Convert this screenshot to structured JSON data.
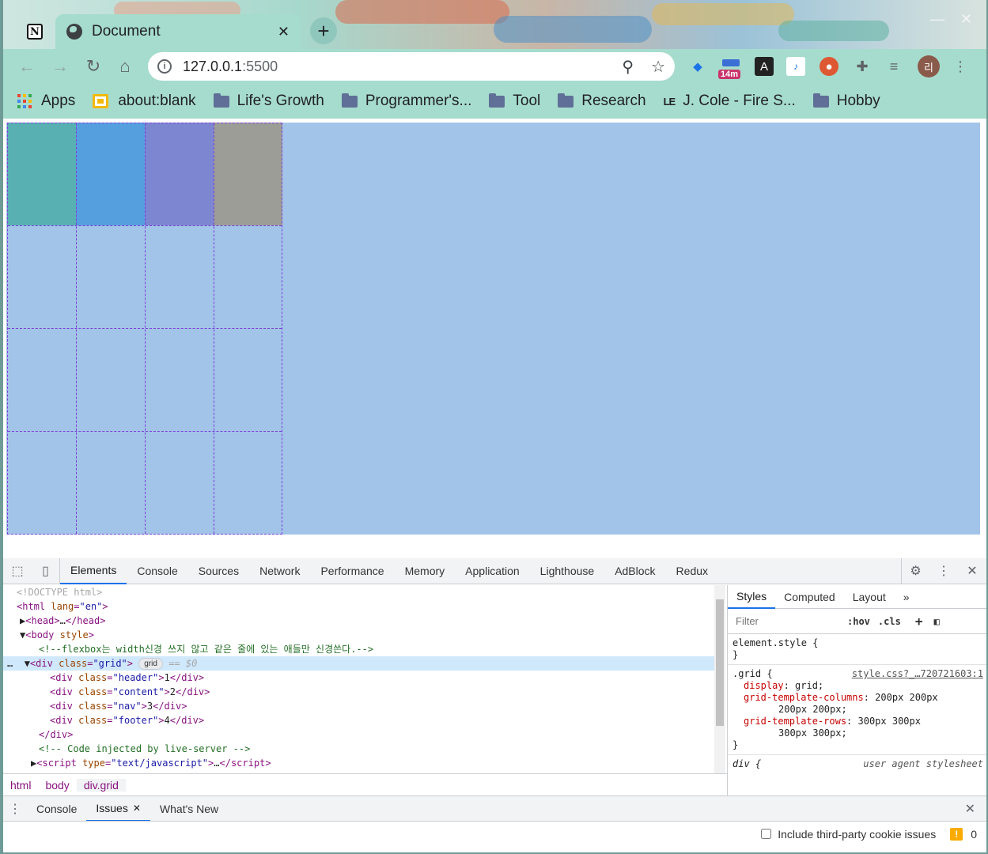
{
  "browser": {
    "tab_title": "Document",
    "tab_close": "✕",
    "new_tab": "+",
    "url_host": "127.0.0.1",
    "url_port": ":5500",
    "extension_badge": "14m",
    "avatar_initial": "리"
  },
  "bookmarks": [
    {
      "label": "Apps",
      "icon": "apps-icon"
    },
    {
      "label": "about:blank",
      "icon": "blank-page-icon"
    },
    {
      "label": "Life's Growth",
      "icon": "folder-icon"
    },
    {
      "label": "Programmer's...",
      "icon": "folder-icon"
    },
    {
      "label": "Tool",
      "icon": "folder-icon"
    },
    {
      "label": "Research",
      "icon": "folder-icon"
    },
    {
      "label": "J. Cole - Fire S...",
      "icon": "le-icon",
      "prefix": "LE"
    },
    {
      "label": "Hobby",
      "icon": "folder-icon"
    }
  ],
  "page": {
    "grid_item_colors": [
      "#58b0b3",
      "#559fdf",
      "#7d87d1",
      "#9c9d96"
    ],
    "grid_background": "#a2c4e8",
    "overlay_line_color": "#7b3fd8"
  },
  "devtools": {
    "tabs": [
      "Elements",
      "Console",
      "Sources",
      "Network",
      "Performance",
      "Memory",
      "Application",
      "Lighthouse",
      "AdBlock",
      "Redux"
    ],
    "active_tab": "Elements",
    "dom": {
      "doctype": "<!DOCTYPE html>",
      "html_open_tag": "html",
      "lang_attr": "lang",
      "lang_val": "\"en\"",
      "head": "head",
      "head_ellipsis": "…",
      "body": "body",
      "body_attr": "style",
      "comment": "<!--flexbox는 width신경 쓰지 않고 같은 줄에 있는 애들만 신경쓴다.-->",
      "div_tag": "div",
      "class_attr": "class",
      "grid_class": "\"grid\"",
      "grid_badge": "grid",
      "dollar_zero": "== $0",
      "children": [
        {
          "cls": "\"header\"",
          "text": "1"
        },
        {
          "cls": "\"content\"",
          "text": "2"
        },
        {
          "cls": "\"nav\"",
          "text": "3"
        },
        {
          "cls": "\"footer\"",
          "text": "4"
        }
      ],
      "close_div": "</div>",
      "live_comment": "<!-- Code injected by live-server -->",
      "script_tag": "script",
      "script_type_attr": "type",
      "script_type_val": "\"text/javascript\"",
      "script_ellipsis": "…"
    },
    "breadcrumbs": [
      "html",
      "body",
      "div.grid"
    ],
    "styles_tabs": [
      "Styles",
      "Computed",
      "Layout",
      "»"
    ],
    "filter_placeholder": "Filter",
    "filter_options": [
      ":hov",
      ".cls",
      "+"
    ],
    "rules": {
      "element_style": "element.style {",
      "close_brace": "}",
      "grid_selector": ".grid {",
      "grid_source": "style.css?_…720721603:1",
      "display_prop": "display",
      "display_val": "grid;",
      "cols_prop": "grid-template-columns",
      "cols_val": "200px 200px",
      "cols_val2": "200px 200px;",
      "rows_prop": "grid-template-rows",
      "rows_val": "300px 300px",
      "rows_val2": "300px 300px;",
      "div_selector": "div {",
      "ua_label": "user agent stylesheet"
    },
    "drawer_tabs": [
      "Console",
      "Issues",
      "What's New"
    ],
    "drawer_active": "Issues",
    "drawer_close": "✕",
    "issues_checkbox_label": "Include third-party cookie issues",
    "issues_count": "0"
  }
}
